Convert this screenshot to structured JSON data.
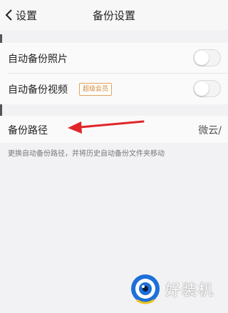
{
  "header": {
    "back_label": "设置",
    "title": "备份设置"
  },
  "settings": {
    "auto_backup_photos": {
      "label": "自动备份照片",
      "enabled": false
    },
    "auto_backup_videos": {
      "label": "自动备份视频",
      "badge": "超级会员",
      "enabled": false
    }
  },
  "backup_path": {
    "label": "备份路径",
    "value": "微云/",
    "hint": "更换自动备份路径，并将历史自动备份文件夹移动"
  },
  "watermark": {
    "text": "好装机"
  },
  "colors": {
    "annotation_arrow": "#e0262b",
    "badge": "#d08a3a",
    "watermark_logo": "#1e6fd9"
  }
}
